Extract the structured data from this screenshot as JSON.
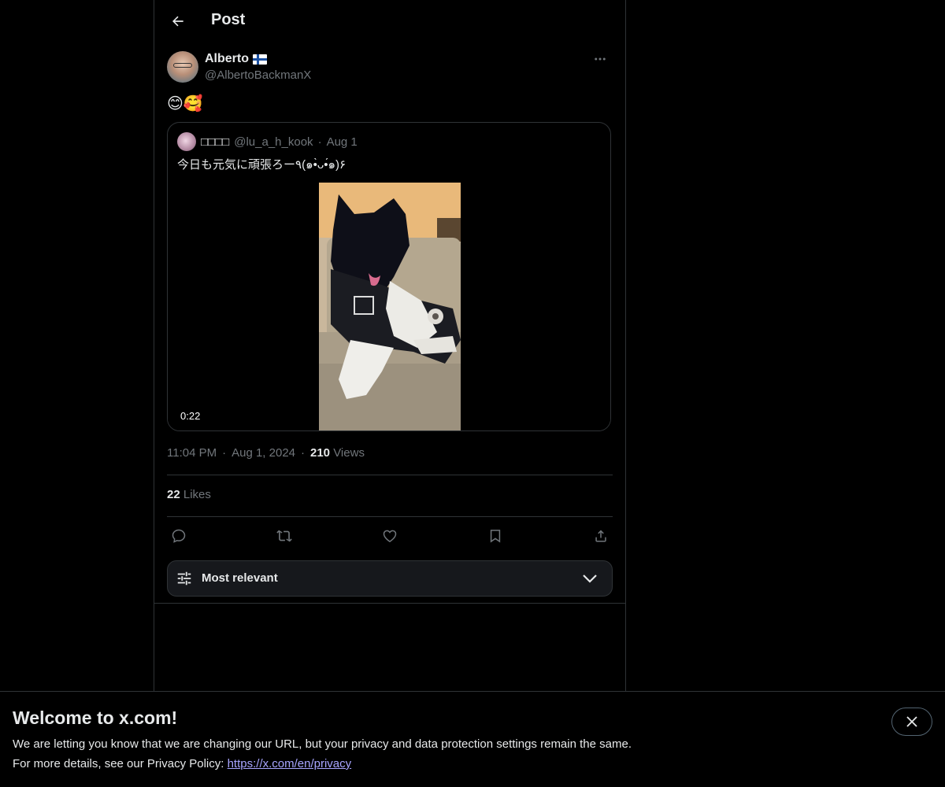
{
  "header": {
    "title": "Post"
  },
  "post": {
    "author_name": "Alberto",
    "author_handle": "@AlbertoBackmanX",
    "text": "😊🥰",
    "time": "11:04 PM",
    "date": "Aug 1, 2024",
    "views_count": "210",
    "views_label": "Views",
    "likes_count": "22",
    "likes_label": "Likes",
    "separator": "·"
  },
  "quote": {
    "name": "□□□□",
    "handle": "@lu_a_h_kook",
    "date": "Aug 1",
    "separator": "·",
    "text": "今日も元気に頑張ろー٩(๑•̀ᴗ•́๑)۶",
    "video_duration": "0:22"
  },
  "sort": {
    "label": "Most relevant"
  },
  "banner": {
    "title": "Welcome to x.com!",
    "line1": "We are letting you know that we are changing our URL, but your privacy and data protection settings remain the same.",
    "line2_prefix": "For more details, see our Privacy Policy: ",
    "link": "https://x.com/en/privacy"
  },
  "icons": {
    "back": "arrow-left-icon",
    "more": "more-horizontal-icon",
    "reply": "reply-icon",
    "repost": "repost-icon",
    "like": "heart-icon",
    "bookmark": "bookmark-icon",
    "share": "share-icon",
    "sort": "sliders-icon",
    "chevron": "chevron-down-icon",
    "close": "close-icon"
  },
  "colors": {
    "background": "#000000",
    "text": "#e7e9ea",
    "muted": "#71767b",
    "border": "#2f3336",
    "link": "#a8a5ff"
  }
}
